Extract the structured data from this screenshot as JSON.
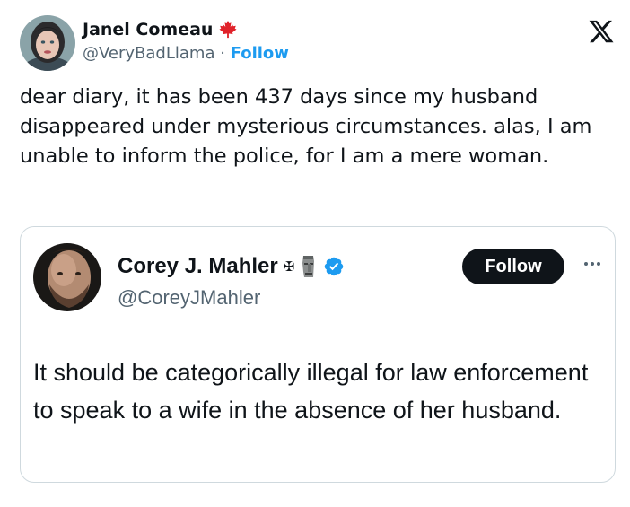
{
  "tweet": {
    "author": {
      "name": "Janel Comeau",
      "handle": "@VeryBadLlama",
      "separator": " · ",
      "follow_label": "Follow",
      "flag_icon": "maple-leaf-icon"
    },
    "text": "dear diary, it has been 437 days since my husband disappeared under mysterious circumstances. alas, I am unable to inform the police, for I am a mere woman."
  },
  "quote": {
    "author": {
      "name": "Corey J. Mahler",
      "name_emoji_1": "✠",
      "name_emoji_2": "moai-icon",
      "verified_icon": "verified-badge-icon",
      "handle": "@CoreyJMahler"
    },
    "follow_label": "Follow",
    "text": "It should be categorically illegal for law enforcement to speak to a wife in the absence of her husband."
  },
  "colors": {
    "link_blue": "#1d9bf0",
    "text_primary": "#0f1419",
    "text_secondary": "#536471",
    "maple_red": "#e0222a",
    "border": "#cfd9de"
  }
}
